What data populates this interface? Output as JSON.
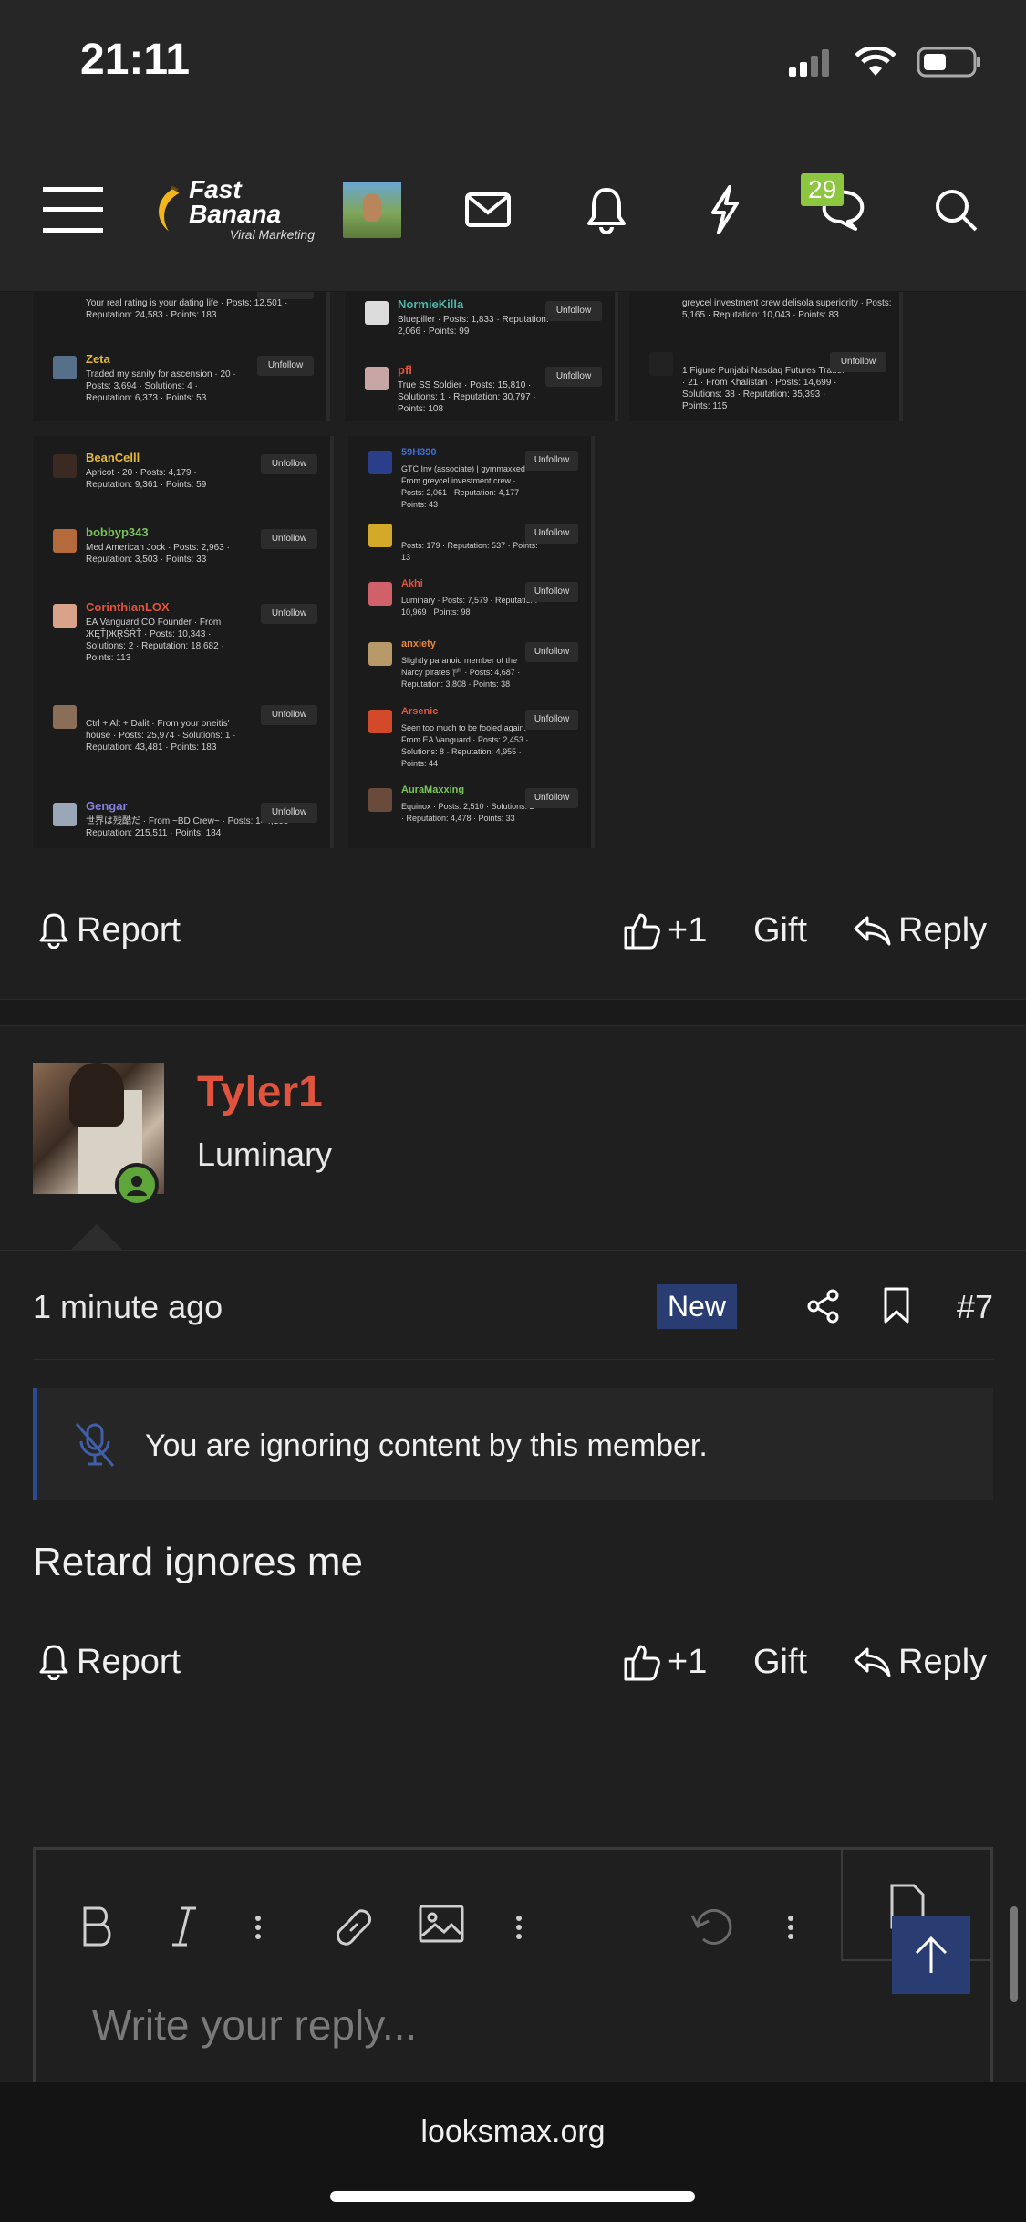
{
  "status_bar": {
    "time": "21:11"
  },
  "nav": {
    "brand_name": "Fast Banana",
    "brand_sub": "Viral Marketing",
    "chat_count": "29"
  },
  "embed": {
    "panels": [
      {
        "rows": [
          {
            "name": "",
            "sub": "Your real rating is your dating life · Posts: 12,501 · Reputation: 24,583 · Points: 183",
            "btn": "Unfollow",
            "color": "#e8e8e8"
          },
          {
            "name": "Zeta",
            "sub": "Traded my sanity for ascension · 20 · Posts: 3,694 · Solutions: 4 · Reputation: 6,373 · Points: 53",
            "btn": "Unfollow",
            "color": "#e2b93b"
          }
        ]
      },
      {
        "rows": [
          {
            "name": "NormieKilla",
            "sub": "Bluepiller · Posts: 1,833 · Reputation: 2,066 · Points: 99",
            "btn": "Unfollow",
            "color": "#4fb3a9"
          },
          {
            "name": "pfl",
            "sub": "True SS Soldier · Posts: 15,810 · Solutions: 1 · Reputation: 30,797 · Points: 108",
            "btn": "Unfollow",
            "color": "#e0533d"
          }
        ]
      },
      {
        "rows": [
          {
            "name": "",
            "sub": "greycel investment crew delisola superiority · Posts: 5,165 · Reputation: 10,043 · Points: 83",
            "btn": "",
            "color": "#e8e8e8"
          },
          {
            "name": "",
            "sub": "1 Figure Punjabi Nasdaq Futures Trader · 21 · From Khalistan · Posts: 14,699 · Solutions: 38 · Reputation: 35,393 · Points: 115",
            "btn": "Unfollow",
            "color": "#a77bd8"
          }
        ]
      },
      {
        "rows": [
          {
            "name": "BeanCelll",
            "sub": "Apricot · 20 · Posts: 4,179 · Reputation: 9,361 · Points: 59",
            "btn": "Unfollow",
            "color": "#e2b93b"
          },
          {
            "name": "bobbyp343",
            "sub": "Med American Jock · Posts: 2,963 · Reputation: 3,503 · Points: 33",
            "btn": "Unfollow",
            "color": "#7ac45a"
          },
          {
            "name": "CorinthianLOX",
            "sub": "EA Vanguard CO Founder · From ЖĘŤĮЖŖŚŔŤ · Posts: 10,343 · Solutions: 2 · Reputation: 18,682 · Points: 113",
            "btn": "Unfollow",
            "color": "#e0533d"
          },
          {
            "name": "",
            "sub": "Ctrl + Alt + Dalit · From your oneitis' house · Posts: 25,974 · Solutions: 1 · Reputation: 43,481 · Points: 183",
            "btn": "Unfollow",
            "color": "#c0399b"
          },
          {
            "name": "Gengar",
            "sub": "世界は残酷だ · From ~BD Crew~ · Posts: 144,165 · Reputation: 215,511 · Points: 184",
            "btn": "Unfollow",
            "color": "#8a7fe0"
          }
        ]
      },
      {
        "rows": [
          {
            "name": "59H390",
            "sub": "GTC Inv (associate) | gymmaxxed · From greycel investment crew · Posts: 2,061 · Reputation: 4,177 · Points: 43",
            "btn": "Unfollow",
            "color": "#3b6fd8"
          },
          {
            "name": "",
            "sub": "Posts: 179 · Reputation: 537 · Points: 13",
            "btn": "Unfollow",
            "color": "#a77bd8"
          },
          {
            "name": "Akhi",
            "sub": "Luminary · Posts: 7,579 · Reputation: 10,969 · Points: 98",
            "btn": "Unfollow",
            "color": "#e0533d"
          },
          {
            "name": "anxiety",
            "sub": "Slightly paranoid member of the Narcy pirates 🏴 · Posts: 4,687 · Reputation: 3,808 · Points: 38",
            "btn": "Unfollow",
            "color": "#e8873b"
          },
          {
            "name": "Arsenic",
            "sub": "Seen too much to be fooled again. · From EA Vanguard · Posts: 2,453 · Solutions: 8 · Reputation: 4,955 · Points: 44",
            "btn": "Unfollow",
            "color": "#e0533d"
          },
          {
            "name": "AuraMaxxing",
            "sub": "Equinox · Posts: 2,510 · Solutions: 2 · Reputation: 4,478 · Points: 33",
            "btn": "Unfollow",
            "color": "#7ac45a"
          }
        ]
      }
    ]
  },
  "actions_top": {
    "report": "Report",
    "like": "+1",
    "gift": "Gift",
    "reply": "Reply"
  },
  "post": {
    "username": "Tyler1",
    "user_title": "Luminary",
    "time_ago": "1 minute ago",
    "new_badge": "New",
    "post_number": "#7",
    "ignore_notice": "You are ignoring content by this member.",
    "body": "Retard ignores me"
  },
  "actions_bottom": {
    "report": "Report",
    "like": "+1",
    "gift": "Gift",
    "reply": "Reply"
  },
  "editor": {
    "placeholder": "Write your reply..."
  },
  "browser": {
    "url": "looksmax.org"
  },
  "colors": {
    "accent_blue": "#2a3d73",
    "username_red": "#e0533d",
    "online_green": "#5ea53a",
    "badge_green": "#8dc63f"
  }
}
